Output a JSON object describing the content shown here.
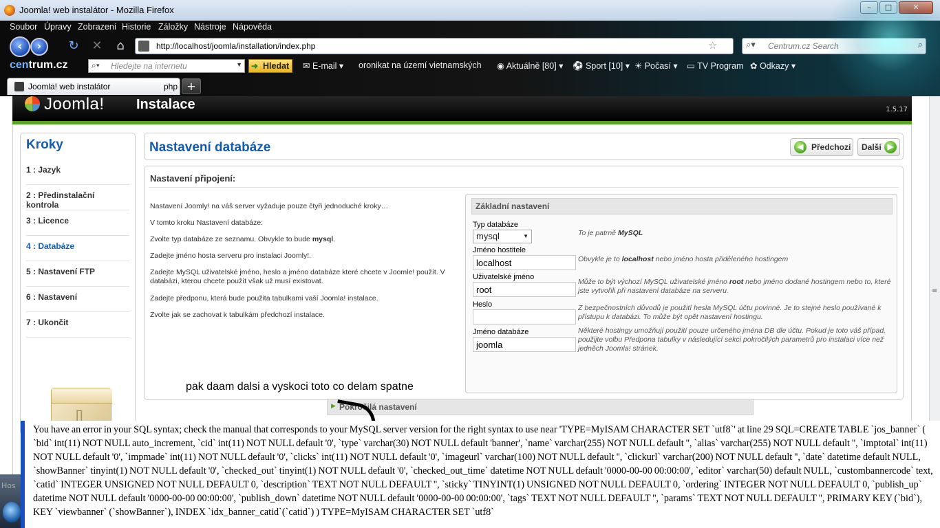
{
  "window": {
    "title": "Joomla! web instalátor - Mozilla Firefox",
    "controls": [
      "–",
      "□",
      "✕"
    ]
  },
  "menu": [
    "Soubor",
    "Úpravy",
    "Zobrazení",
    "Historie",
    "Záložky",
    "Nástroje",
    "Nápověda"
  ],
  "navigation": {
    "url": "http://localhost/joomla/installation/index.php",
    "search_placeholder": "Centrum.cz Search"
  },
  "toolbar": {
    "logo_a": "cen",
    "logo_b": "trum.cz",
    "search_placeholder": "Hledejte na internetu",
    "search_button": "Hledat",
    "email": "E-mail",
    "news": "oronikat na území vietnamských",
    "current": "Aktuálně [80]",
    "sport": "Sport [10]",
    "weather": "Počasí",
    "tv": "TV Program",
    "links": "Odkazy"
  },
  "tabs": {
    "active_label": "Joomla! web instalátor",
    "overflow_label": "php",
    "new_tab": "+"
  },
  "joomla": {
    "brand": "Joomla!",
    "section": "Instalace",
    "version": "1.5.17"
  },
  "steps": {
    "heading": "Kroky",
    "items": [
      {
        "label": "1 : Jazyk",
        "active": false
      },
      {
        "label": "2 : Předinstalační kontrola",
        "active": false
      },
      {
        "label": "3 : Licence",
        "active": false
      },
      {
        "label": "4 : Databáze",
        "active": true
      },
      {
        "label": "5 : Nastavení FTP",
        "active": false
      },
      {
        "label": "6 : Nastavení",
        "active": false
      },
      {
        "label": "7 : Ukončit",
        "active": false
      }
    ]
  },
  "main": {
    "title": "Nastavení databáze",
    "prev_button": "Předchozí",
    "next_button": "Další",
    "section_title": "Nastavení připojení:",
    "paragraphs": [
      "Nastavení Joomly! na váš server vyžaduje pouze čtyři jednoduché kroky…",
      "V tomto kroku Nastavení databáze:",
      "Zvolte typ databáze ze seznamu. Obvykle to bude ",
      "Zadejte jméno hosta serveru pro instalaci Joomly!.",
      "Zadejte MySQL uživatelské jméno, heslo a jméno databáze které chcete v Joomle! použít. V databázi, kterou chcete použít však už musí existovat.",
      "Zadejte předponu, která bude použita tabulkami vaší Joomla! instalace.",
      "Zvolte jak se zachovat k tabulkám předchozí instalace."
    ],
    "para3_bold": "mysql",
    "para3_end": "."
  },
  "basic": {
    "header": "Základní nastavení",
    "db_type_label": "Typ databáze",
    "db_type_value": "mysql",
    "db_type_hint_pre": "To je patrně ",
    "db_type_hint_bold": "MySQL",
    "host_label": "Jméno hostitele",
    "host_value": "localhost",
    "host_hint_pre": "Obvykle je to ",
    "host_hint_bold": "localhost",
    "host_hint_post": " nebo jméno hosta přiděleného hostingem",
    "user_label": "Uživatelské jméno",
    "user_value": "root",
    "user_hint_pre": "Může to být výchozí MySQL uživatelské jméno ",
    "user_hint_bold": "root",
    "user_hint_post": " nebo jméno dodané hostingem nebo to, které jste vytvořili při nastavení databáze na serveru.",
    "pass_label": "Heslo",
    "pass_value": "",
    "pass_hint": "Z bezpečnostních důvodů je použití hesla MySQL účtu povinné. Je to stejné heslo používané k přístupu k databázi. To může být opět nastavení hostingu.",
    "dbname_label": "Jméno databáze",
    "dbname_value": "joomla",
    "dbname_hint": "Některé hostingy umožňují použití pouze určeného jména DB dle účtu. Pokud je toto váš případ, použijte volbu Předpona tabulky v následující sekci pokročilých parametrů pro instalaci více než jedněch Joomla! stránek."
  },
  "advanced": {
    "label": "Pokročilá nastavení"
  },
  "annotation": {
    "note": "pak daam dalsi a vyskoci toto co delam spatne"
  },
  "error": {
    "text": "You have an error in your SQL syntax; check the manual that corresponds to your MySQL server version for the right syntax to use near 'TYPE=MyISAM CHARACTER SET `utf8`' at line 29 SQL=CREATE TABLE `jos_banner` ( `bid` int(11) NOT NULL auto_increment, `cid` int(11) NOT NULL default '0', `type` varchar(30) NOT NULL default 'banner', `name` varchar(255) NOT NULL default '', `alias` varchar(255) NOT NULL default '', `imptotal` int(11) NOT NULL default '0', `impmade` int(11) NOT NULL default '0', `clicks` int(11) NOT NULL default '0', `imageurl` varchar(100) NOT NULL default '', `clickurl` varchar(200) NOT NULL default '', `date` datetime default NULL, `showBanner` tinyint(1) NOT NULL default '0', `checked_out` tinyint(1) NOT NULL default '0', `checked_out_time` datetime NOT NULL default '0000-00-00 00:00:00', `editor` varchar(50) default NULL, `custombannercode` text, `catid` INTEGER UNSIGNED NOT NULL DEFAULT 0, `description` TEXT NOT NULL DEFAULT '', `sticky` TINYINT(1) UNSIGNED NOT NULL DEFAULT 0, `ordering` INTEGER NOT NULL DEFAULT 0, `publish_up` datetime NOT NULL default '0000-00-00 00:00:00', `publish_down` datetime NOT NULL default '0000-00-00 00:00:00', `tags` TEXT NOT NULL DEFAULT '', `params` TEXT NOT NULL DEFAULT '', PRIMARY KEY (`bid`), KEY `viewbanner` (`showBanner`), INDEX `idx_banner_catid`(`catid`) ) TYPE=MyISAM CHARACTER SET `utf8`"
  },
  "taskbar": {
    "host_text": "Hos"
  }
}
